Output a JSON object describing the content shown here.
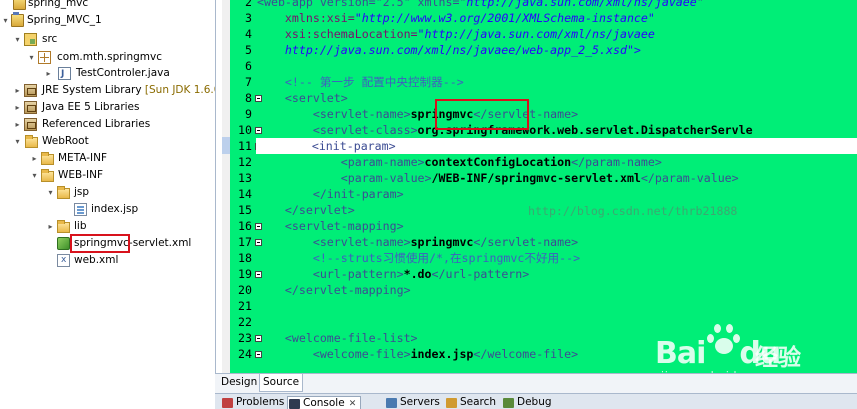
{
  "explorer": {
    "items": [
      {
        "label": "spring_mvc",
        "extra": ""
      },
      {
        "label": "Spring_MVC_1",
        "extra": ""
      },
      {
        "label": "src",
        "extra": ""
      },
      {
        "label": "com.mth.springmvc",
        "extra": ""
      },
      {
        "label": "TestControler.java",
        "extra": ""
      },
      {
        "label": "JRE System Library",
        "extra": "[Sun JDK 1.6.0_"
      },
      {
        "label": "Java EE 5 Libraries",
        "extra": ""
      },
      {
        "label": "Referenced Libraries",
        "extra": ""
      },
      {
        "label": "WebRoot",
        "extra": ""
      },
      {
        "label": "META-INF",
        "extra": ""
      },
      {
        "label": "WEB-INF",
        "extra": ""
      },
      {
        "label": "jsp",
        "extra": ""
      },
      {
        "label": "index.jsp",
        "extra": ""
      },
      {
        "label": "lib",
        "extra": ""
      },
      {
        "label": "springmvc-servlet.xml",
        "extra": ""
      },
      {
        "label": "web.xml",
        "extra": ""
      }
    ]
  },
  "editor": {
    "line_numbers": [
      "2",
      "3",
      "4",
      "5",
      "6",
      "7",
      "8",
      "9",
      "10",
      "11",
      "12",
      "13",
      "14",
      "15",
      "16",
      "17",
      "18",
      "19",
      "20",
      "21",
      "22",
      "23",
      "24"
    ],
    "watermark": "http://blog.csdn.net/thrb21888",
    "code": {
      "l2_a": "<web-app version=\"2.5\" xmlns=\"",
      "l2_b": "http://java.sun.com/xml/ns/javaee",
      "l2_c": "\"",
      "l3_a": "xmlns:xsi=",
      "l3_b": "\"http://www.w3.org/2001/XMLSchema-instance\"",
      "l4_a": "xsi:schemaLocation=",
      "l4_b": "\"http://java.sun.com/xml/ns/javaee",
      "l5": "http://java.sun.com/xml/ns/javaee/web-app_2_5.xsd\">",
      "l7": "<!-- 第一步 配置中央控制器-->",
      "l8": "<servlet>",
      "l9_a": "<servlet-name>",
      "l9_b": "springmvc",
      "l9_c": "</servlet-name>",
      "l10_a": "<servlet-class>",
      "l10_b": "org.springframework.web.servlet.DispatcherServle",
      "l11": "<init-param>",
      "l12_a": "<param-name>",
      "l12_b": "contextConfigLocation",
      "l12_c": "</param-name>",
      "l13_a": "<param-value>",
      "l13_b": "/WEB-INF/springmvc-servlet.xml",
      "l13_c": "</param-value>",
      "l14": "</init-param>",
      "l15": "</servlet>",
      "l16": "<servlet-mapping>",
      "l17_a": "<servlet-name>",
      "l17_b": "springmvc",
      "l17_c": "</servlet-name>",
      "l18": "<!--struts习惯使用/*,在springmvc不好用-->",
      "l19_a": "<url-pattern>",
      "l19_b": "*.do",
      "l19_c": "</url-pattern>",
      "l20": "</servlet-mapping>",
      "l23": "<welcome-file-list>",
      "l24_a": "<welcome-file>",
      "l24_b": "index.jsp",
      "l24_c": "</welcome-file>"
    }
  },
  "editor_tabs": {
    "design": "Design",
    "source": "Source"
  },
  "views": [
    {
      "label": "Problems",
      "icon": "problems-icon",
      "color": "#c04040"
    },
    {
      "label": "Console",
      "icon": "console-icon",
      "color": "#303a50"
    },
    {
      "label": "Servers",
      "icon": "servers-icon",
      "color": "#4a7ab0"
    },
    {
      "label": "Search",
      "icon": "search-icon",
      "color": "#d09a30"
    },
    {
      "label": "Debug",
      "icon": "debug-icon",
      "color": "#5a8a3a"
    }
  ],
  "baidu": {
    "brand": "Bai",
    "brand_tail": "du",
    "brand2": "经验",
    "url": "jingyan.baidu.com"
  },
  "colors": {
    "editor_bg": "#00ee77",
    "highlight": "#d8121c"
  }
}
